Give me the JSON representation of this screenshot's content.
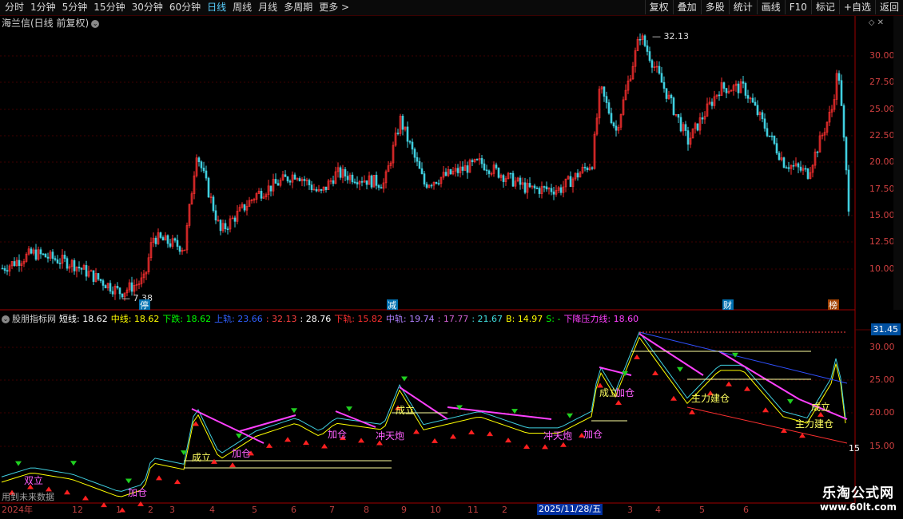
{
  "toolbar": {
    "periods": [
      "分时",
      "1分钟",
      "5分钟",
      "15分钟",
      "30分钟",
      "60分钟",
      "日线",
      "周线",
      "月线",
      "多周期",
      "更多 >"
    ],
    "active_period": "日线",
    "buttons": [
      "复权",
      "叠加",
      "多股",
      "统计",
      "画线",
      "F10",
      "标记",
      "+自选",
      "返回"
    ]
  },
  "main": {
    "title": "海兰信(日线 前复权)",
    "high_label": "32.13",
    "low_label": "7.38",
    "y_ticks": [
      "30.00",
      "27.50",
      "25.00",
      "22.50",
      "20.00",
      "17.50",
      "15.00",
      "12.50",
      "10.00"
    ],
    "event_markers": [
      "停",
      "减",
      "财",
      "榜"
    ]
  },
  "indicator": {
    "name": "股朋指标网",
    "values": [
      {
        "label": "短线: 18.62",
        "color": "#ffffff"
      },
      {
        "label": "中线: 18.62",
        "color": "#ffff00"
      },
      {
        "label": "下跌: 18.62",
        "color": "#00ff00"
      },
      {
        "label": "上轨: 23.66",
        "color": "#3060ff"
      },
      {
        "label": ": 32.13",
        "color": "#ff4040"
      },
      {
        "label": ": 28.76",
        "color": "#ffffff"
      },
      {
        "label": "下轨: 15.82",
        "color": "#ff3030"
      },
      {
        "label": "中轨: 19.74",
        "color": "#b080ff"
      },
      {
        "label": ": 17.77",
        "color": "#d060d0"
      },
      {
        "label": ": 21.67",
        "color": "#40e0e0"
      },
      {
        "label": "B: 14.97",
        "color": "#ffff00"
      },
      {
        "label": "S: -",
        "color": "#00ff00"
      },
      {
        "label": "下降压力线: 18.60",
        "color": "#ff40ff"
      }
    ],
    "y_ticks": [
      "30.00",
      "25.00",
      "20.00",
      "15.00"
    ],
    "price_tag": "31.45",
    "last_label": "15",
    "annotations": [
      "卖",
      "买",
      "加仓",
      "成立",
      "主力建仓",
      "冲天炮",
      "双立"
    ],
    "footnote": "用到未来数据"
  },
  "xaxis": {
    "labels": [
      "2024年",
      "12",
      "1",
      "2",
      "3",
      "4",
      "5",
      "6",
      "7",
      "8",
      "9",
      "10",
      "11",
      "2",
      "3",
      "4",
      "5",
      "6"
    ],
    "selected": "2025/11/28/五"
  },
  "logo": {
    "line1": "乐淘公式网",
    "line2": "www.60lt.com"
  }
}
